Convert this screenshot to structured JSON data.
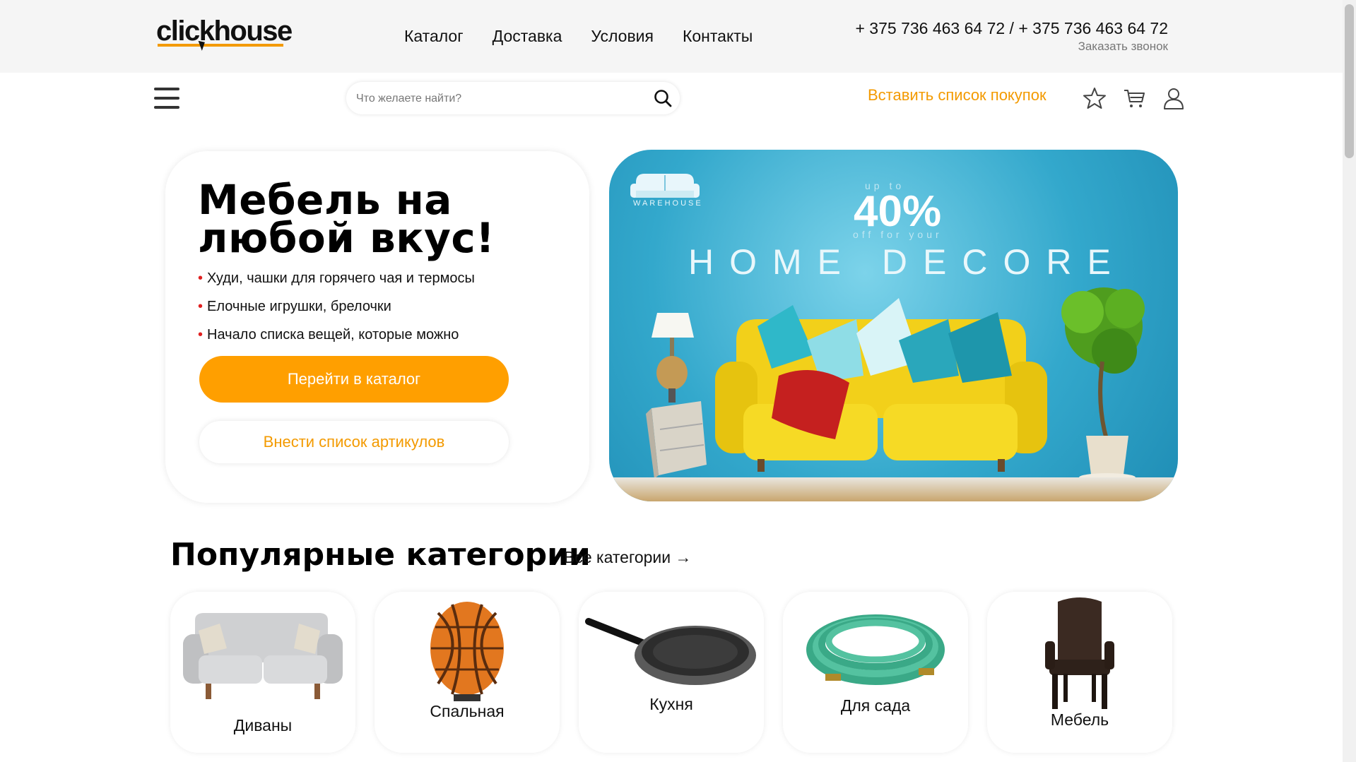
{
  "header": {
    "logo_text": "clickhouse",
    "nav": [
      "Каталог",
      "Доставка",
      "Условия",
      "Контакты"
    ],
    "phones": "+ 375 736 463 64 72 / + 375 736 463 64 72",
    "callback": "Заказать звонок"
  },
  "toolbar": {
    "search_placeholder": "Что желаете найти?",
    "insert_list": "Вставить список покупок",
    "icons": [
      "menu-icon",
      "search-icon",
      "star-icon",
      "cart-icon",
      "user-icon"
    ]
  },
  "hero": {
    "title": "Мебель на любой вкус!",
    "bullets": [
      "Худи, чашки для горячего чая и термосы",
      "Елочные игрушки, брелочки",
      "Начало списка вещей, которые можно"
    ],
    "catalog_button": "Перейти в каталог",
    "articles_button": "Внести список артикулов"
  },
  "banner": {
    "logo_text": "WAREHOUSE",
    "upto": "up to",
    "percent": "40%",
    "off_for": "off for your",
    "headline": "HOME DECORE"
  },
  "popular": {
    "title": "Популярные категории",
    "all_link": "Все категории →",
    "categories": [
      {
        "label": "Диваны",
        "icon": "sofa-icon"
      },
      {
        "label": "Спальная",
        "icon": "lamp-icon"
      },
      {
        "label": "Кухня",
        "icon": "pan-icon"
      },
      {
        "label": "Для сада",
        "icon": "hose-icon"
      },
      {
        "label": "Мебель",
        "icon": "chair-icon"
      }
    ]
  },
  "colors": {
    "accent": "#FF9F00",
    "accent_text": "#F39A00",
    "bullet": "#E02020",
    "topbar": "#F5F5F5"
  }
}
